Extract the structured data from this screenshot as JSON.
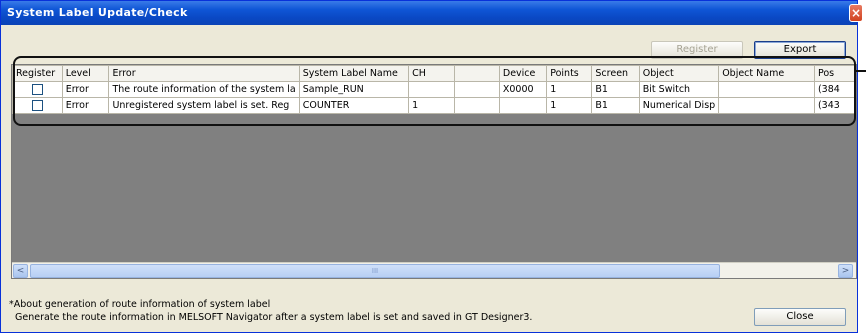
{
  "window": {
    "title": "System Label Update/Check",
    "close_glyph": "×"
  },
  "toolbar": {
    "register_label": "Register",
    "export_label": "Export"
  },
  "table": {
    "headers": [
      "Register",
      "Level",
      "Error",
      "System Label Name",
      "CH",
      "",
      "Device",
      "Points",
      "Screen",
      "Object",
      "Object Name",
      "Pos"
    ],
    "rows": [
      {
        "register_checked": false,
        "level": "Error",
        "error": "The route information of the system la",
        "label": "Sample_RUN",
        "ch": "",
        "blank": "",
        "device": "X0000",
        "points": "1",
        "screen": "B1",
        "object": "Bit Switch",
        "object_name": "",
        "pos": "(384"
      },
      {
        "register_checked": false,
        "level": "Error",
        "error": "Unregistered system label is set. Reg",
        "label": "COUNTER",
        "ch": "1",
        "blank": "",
        "device": "",
        "points": "1",
        "screen": "B1",
        "object": "Numerical Disp",
        "object_name": "",
        "pos": "(343"
      }
    ]
  },
  "scrollbar": {
    "left_arrow": "<",
    "right_arrow": ">",
    "grip": "III"
  },
  "footer": {
    "note_line1": "*About generation of route information of system label",
    "note_line2": "Generate the route information in MELSOFT Navigator after a system label is set and saved in GT Designer3.",
    "close_label": "Close"
  }
}
